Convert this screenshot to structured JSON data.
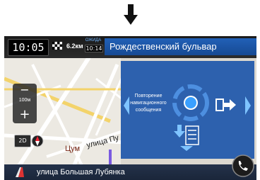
{
  "header": {
    "clock": "10:05",
    "distance": "6.2км",
    "eta_label": "ОЖИДА",
    "eta_time": "10:14",
    "street_name": "Рождественский бульвар"
  },
  "zoom": {
    "minus": "−",
    "scale": "100м",
    "plus": "+"
  },
  "view_mode": "2D",
  "map_labels": {
    "district": "Цум",
    "street_partial": "улица Пу"
  },
  "overlay": {
    "repeat_prompt": "Повторение навигационного сообщения"
  },
  "footer": {
    "current_street": "улица Большая Лубянка"
  },
  "icons": [
    "down-arrow-icon",
    "flag-icon",
    "compass-icon",
    "chevron-left-icon",
    "chevron-right-icon",
    "joystick-icon",
    "exit-arrow-icon",
    "maneuver-list-icon",
    "route-icon",
    "phone-icon"
  ],
  "colors": {
    "accent": "#1f5fb8",
    "overlay": "#1450aa",
    "bar": "#1a1a1a"
  }
}
